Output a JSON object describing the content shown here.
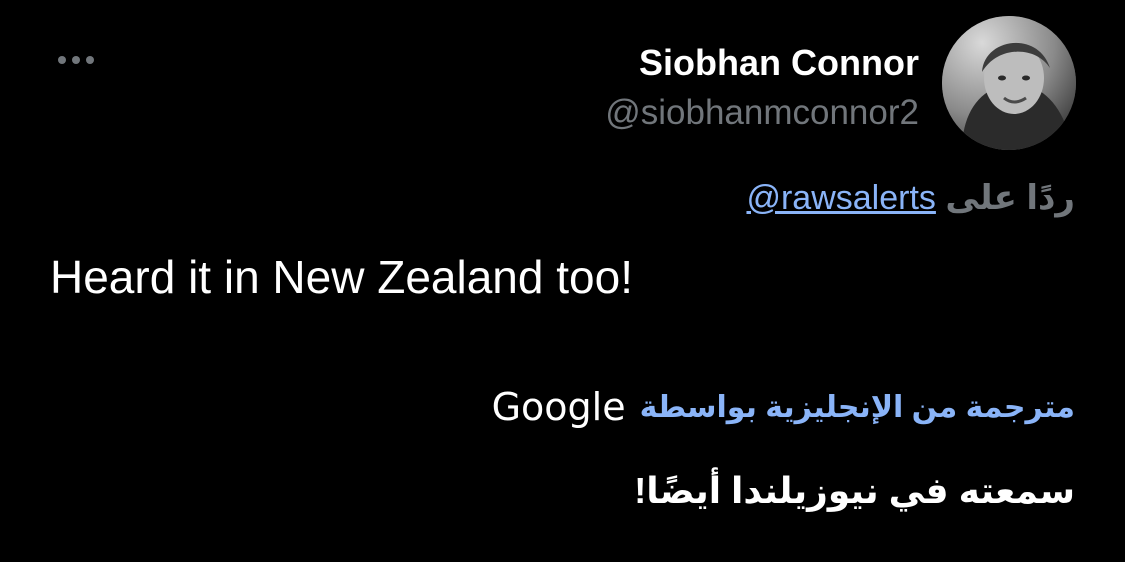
{
  "author": {
    "display_name": "Siobhan Connor",
    "handle": "@siobhanmconnor2",
    "avatar_icon": "profile-photo"
  },
  "reply": {
    "prefix": "ردًا على",
    "mention": "@rawsalerts"
  },
  "tweet": {
    "text": "Heard it in New Zealand too!"
  },
  "translation": {
    "label": "مترجمة من الإنجليزية بواسطة",
    "provider": "Google",
    "text": "سمعته في نيوزيلندا أيضًا!"
  },
  "colors": {
    "background": "#000000",
    "primary_text": "#ffffff",
    "secondary_text": "#71767b",
    "link": "#8ab4f8"
  },
  "icons": {
    "more": "more-horizontal-icon"
  }
}
